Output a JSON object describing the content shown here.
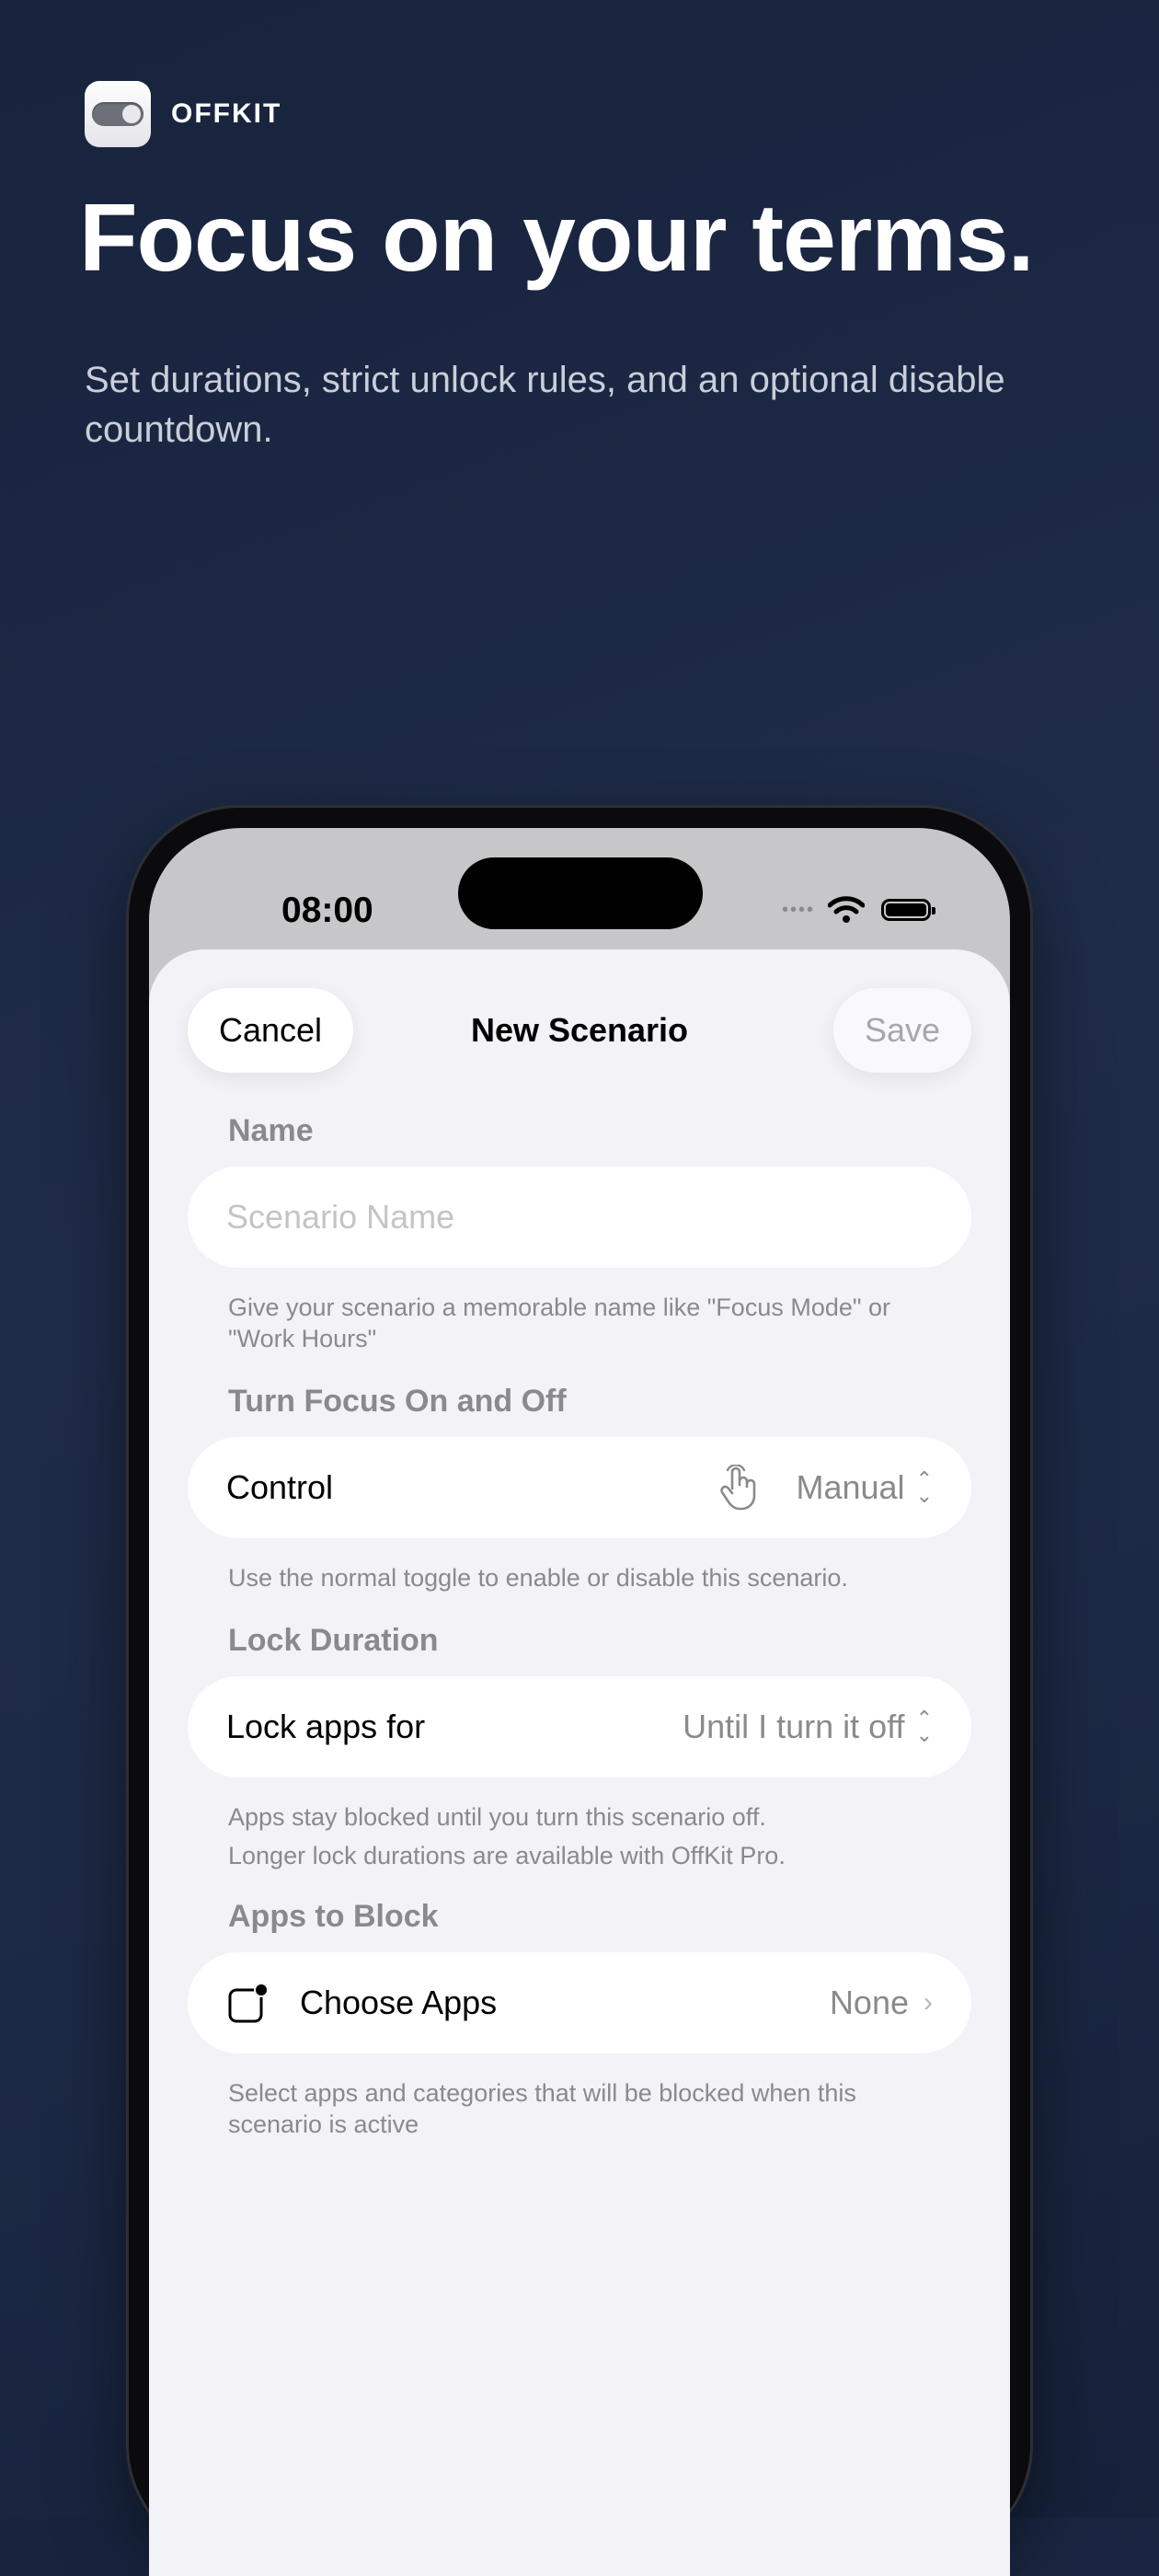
{
  "brand": {
    "name": "OFFKIT"
  },
  "hero": {
    "headline": "Focus on your terms.",
    "subhead": "Set durations, strict unlock rules, and an optional disable countdown."
  },
  "status_bar": {
    "time": "08:00"
  },
  "nav": {
    "cancel_label": "Cancel",
    "title": "New Scenario",
    "save_label": "Save"
  },
  "name_section": {
    "label": "Name",
    "placeholder": "Scenario Name",
    "footnote": "Give your scenario a memorable name like \"Focus Mode\" or \"Work Hours\""
  },
  "control_section": {
    "label": "Turn Focus On and Off",
    "row_label": "Control",
    "row_value": "Manual",
    "footnote": "Use the normal toggle to enable or disable this scenario."
  },
  "duration_section": {
    "label": "Lock Duration",
    "row_label": "Lock apps for",
    "row_value": "Until I turn it off",
    "footnote_1": "Apps stay blocked until you turn this scenario off.",
    "footnote_2": "Longer lock durations are available with OffKit Pro."
  },
  "apps_section": {
    "label": "Apps to Block",
    "row_label": "Choose Apps",
    "row_value": "None",
    "footnote": "Select apps and categories that will be blocked when this scenario is active"
  },
  "icons": {
    "brand": "toggle-switch-icon",
    "control": "hand-pointer-icon",
    "apps": "app-badge-icon",
    "wifi": "wifi-icon",
    "battery": "battery-icon"
  }
}
